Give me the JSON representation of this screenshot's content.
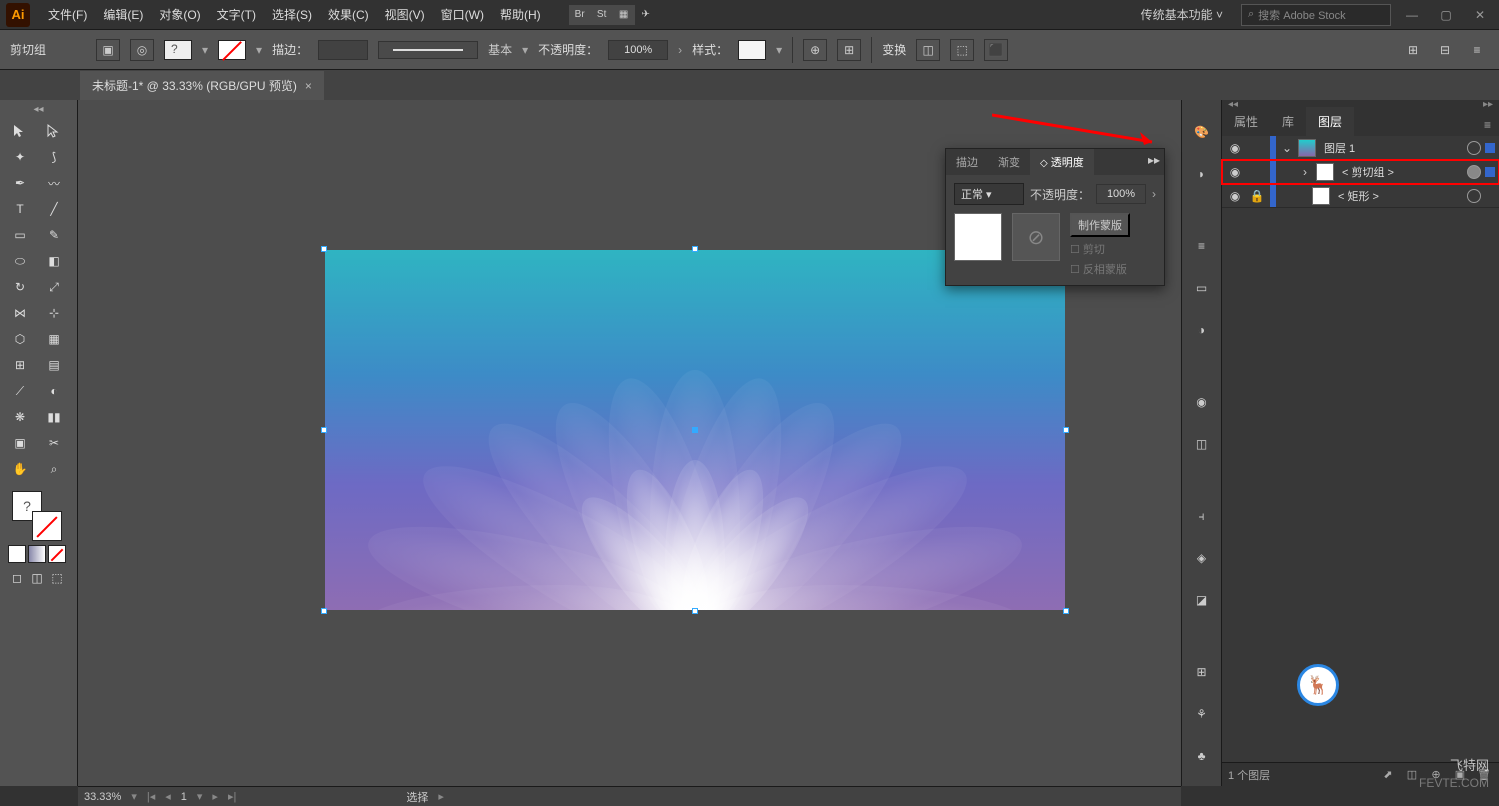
{
  "app_logo": "Ai",
  "menu": {
    "file": "文件(F)",
    "edit": "编辑(E)",
    "object": "对象(O)",
    "type": "文字(T)",
    "select": "选择(S)",
    "effect": "效果(C)",
    "view": "视图(V)",
    "window": "窗口(W)",
    "help": "帮助(H)"
  },
  "topbar_buttons": {
    "br": "Br",
    "st": "St"
  },
  "workspace": "传统基本功能",
  "search_placeholder": "搜索 Adobe Stock",
  "options": {
    "selection_label": "剪切组",
    "stroke_label": "描边：",
    "stroke_style": "基本",
    "opacity_label": "不透明度：",
    "opacity_value": "100%",
    "style_label": "样式：",
    "transform_label": "变换"
  },
  "document": {
    "tab_title": "未标题-1* @ 33.33% (RGB/GPU 预览)"
  },
  "transparency_panel": {
    "tab_stroke": "描边",
    "tab_gradient": "渐变",
    "tab_transparency": "透明度",
    "blend_mode": "正常",
    "opacity_label": "不透明度：",
    "opacity_value": "100%",
    "make_mask": "制作蒙版",
    "clip": "剪切",
    "invert": "反相蒙版"
  },
  "right_panel": {
    "tab_properties": "属性",
    "tab_libraries": "库",
    "tab_layers": "图层",
    "layers": [
      {
        "name": "图层 1",
        "indent": 0,
        "expanded": true,
        "locked": false,
        "highlight": false,
        "selected": true
      },
      {
        "name": "< 剪切组 >",
        "indent": 1,
        "expanded": false,
        "locked": false,
        "highlight": true,
        "selected": true
      },
      {
        "name": "< 矩形 >",
        "indent": 1,
        "expanded": false,
        "locked": true,
        "highlight": false,
        "selected": false
      }
    ],
    "footer_count": "1 个图层"
  },
  "status": {
    "zoom": "33.33%",
    "page": "1",
    "tool": "选择"
  },
  "watermark1": "飞特网",
  "watermark2": "FEVTE.COM"
}
